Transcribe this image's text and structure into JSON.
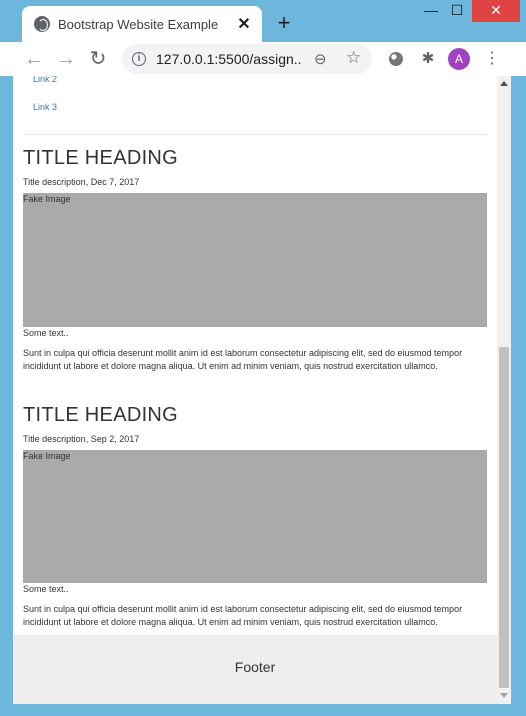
{
  "browser": {
    "tab_title": "Bootstrap Website Example",
    "tab_close": "✕",
    "new_tab": "+",
    "url": "127.0.0.1:5500/assign...",
    "avatar_letter": "A",
    "window_controls": {
      "minimize": "—",
      "maximize": "☐",
      "close": "✕"
    },
    "nav": {
      "back": "←",
      "forward": "→",
      "reload": "↻"
    },
    "omnibox_icons": {
      "info": "i",
      "zoom": "⊖",
      "star": "☆"
    },
    "extension_icon": "✱",
    "menu": "⋮"
  },
  "sidebar_links": [
    "Link 2",
    "Link 3"
  ],
  "posts": [
    {
      "title": "TITLE HEADING",
      "description": "Title description, Dec 7, 2017",
      "image_label": "Fake Image",
      "some_text": "Some text..",
      "paragraph": "Sunt in culpa qui officia deserunt mollit anim id est laborum consectetur adipiscing elit, sed do eiusmod tempor incididunt ut labore et dolore magna aliqua. Ut enim ad minim veniam, quis nostrud exercitation ullamco."
    },
    {
      "title": "TITLE HEADING",
      "description": "Title description, Sep 2, 2017",
      "image_label": "Fake Image",
      "some_text": "Some text..",
      "paragraph": "Sunt in culpa qui officia deserunt mollit anim id est laborum consectetur adipiscing elit, sed do eiusmod tempor incididunt ut labore et dolore magna aliqua. Ut enim ad minim veniam, quis nostrud exercitation ullamco."
    }
  ],
  "footer": {
    "text": "Footer"
  },
  "colors": {
    "frame": "#6eb7dc",
    "link": "#337ab7",
    "fake_image": "#aaaaaa",
    "footer_bg": "#eeeeee",
    "avatar": "#a142c2"
  }
}
